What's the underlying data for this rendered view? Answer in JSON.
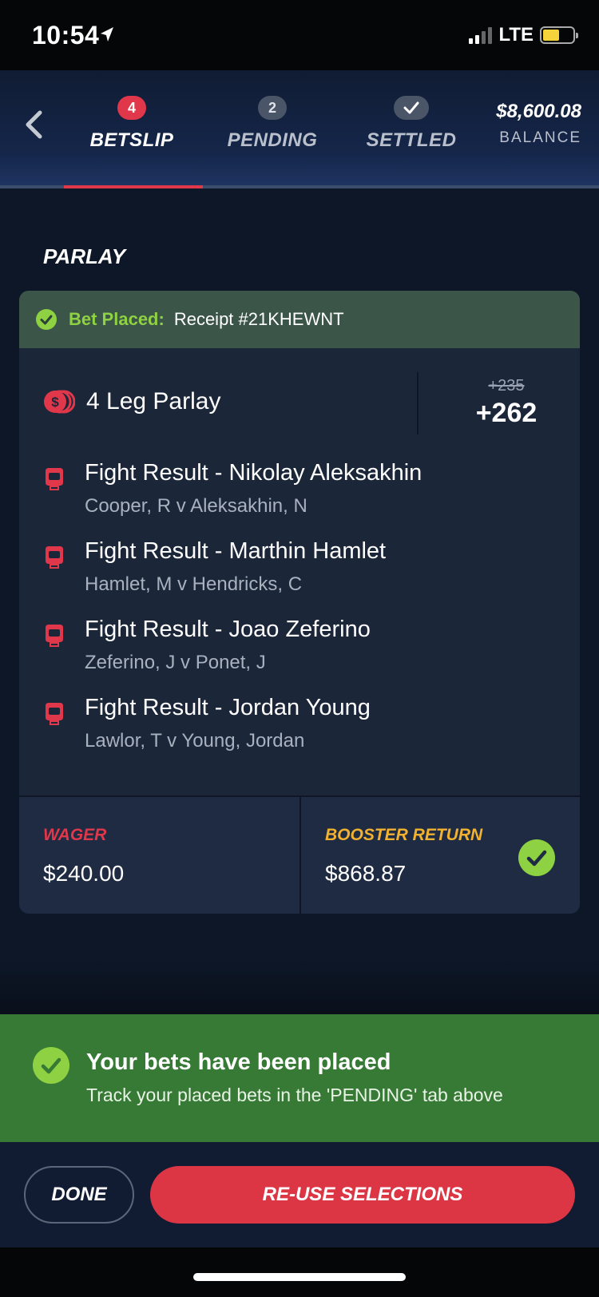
{
  "status_bar": {
    "time": "10:54",
    "network": "LTE"
  },
  "tabs": [
    {
      "badge": "4",
      "label": "BETSLIP",
      "active": true
    },
    {
      "badge": "2",
      "label": "PENDING",
      "active": false
    },
    {
      "badge_icon": "check-icon",
      "label": "SETTLED",
      "active": false
    }
  ],
  "balance": {
    "amount": "$8,600.08",
    "label": "BALANCE"
  },
  "section_title": "PARLAY",
  "bet": {
    "placed_label": "Bet Placed:",
    "receipt": "Receipt #21KHEWNT",
    "parlay_name": "4 Leg Parlay",
    "original_odds": "+235",
    "boosted_odds": "+262",
    "legs": [
      {
        "market": "Fight Result - Nikolay Aleksakhin",
        "event": "Cooper, R v Aleksakhin, N"
      },
      {
        "market": "Fight Result - Marthin Hamlet",
        "event": "Hamlet, M v Hendricks, C"
      },
      {
        "market": "Fight Result - Joao Zeferino",
        "event": "Zeferino, J v Ponet, J"
      },
      {
        "market": "Fight Result - Jordan Young",
        "event": "Lawlor, T v Young, Jordan"
      }
    ],
    "wager_label": "WAGER",
    "wager_value": "$240.00",
    "booster_label": "BOOSTER RETURN",
    "booster_value": "$868.87"
  },
  "toast": {
    "title": "Your bets have been placed",
    "subtitle": "Track your placed bets in the 'PENDING' tab above"
  },
  "actions": {
    "done_label": "DONE",
    "reuse_label": "RE-USE SELECTIONS"
  },
  "colors": {
    "accent_red": "#e0384a",
    "success_green": "#8ed142",
    "booster_gold": "#f2b230",
    "toast_green": "#367a36"
  }
}
